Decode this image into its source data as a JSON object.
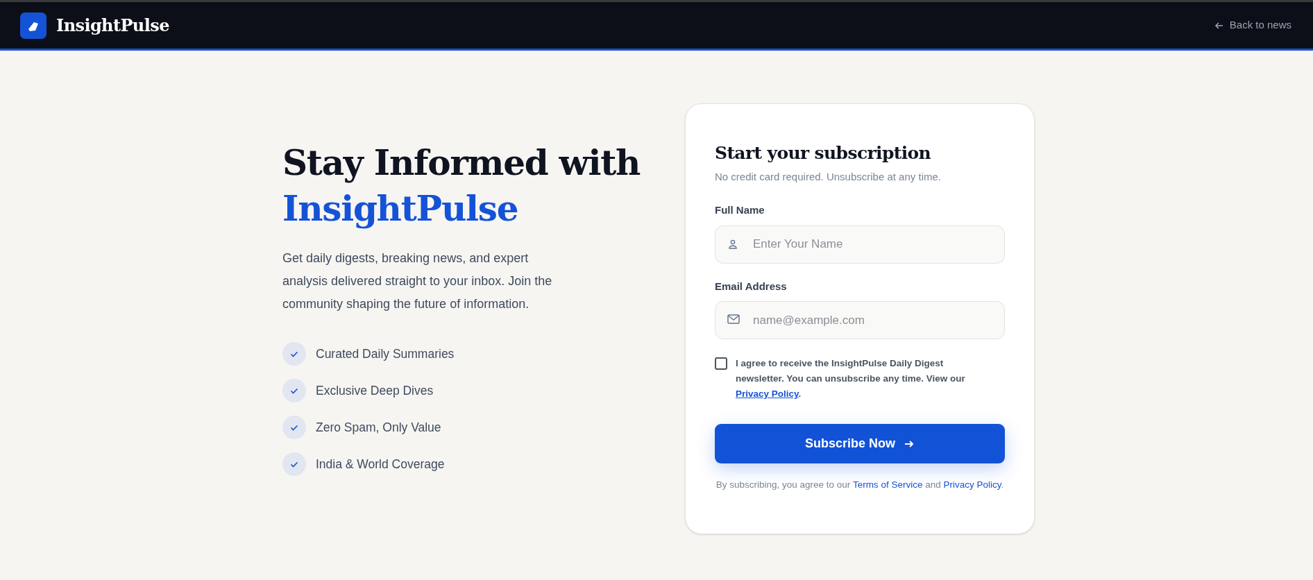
{
  "header": {
    "brand": "InsightPulse",
    "back_link": "Back to news"
  },
  "hero": {
    "title_parts": [
      {
        "kind": "text",
        "text": "Stay Informed with "
      },
      {
        "kind": "accent",
        "text": "InsightPulse"
      }
    ],
    "description": "Get daily digests, breaking news, and expert analysis delivered straight to your inbox. Join the community shaping the future of information.",
    "features": [
      {
        "label": "Curated Daily Summaries"
      },
      {
        "label": "Exclusive Deep Dives"
      },
      {
        "label": "Zero Spam, Only Value"
      },
      {
        "label": "India & World Coverage"
      }
    ]
  },
  "form": {
    "title": "Start your subscription",
    "subtitle": "No credit card required. Unsubscribe at any time.",
    "fields": [
      {
        "kind": "name",
        "label": "Full Name",
        "placeholder": "Enter Your Name"
      },
      {
        "kind": "email",
        "label": "Email Address",
        "placeholder": "name@example.com"
      }
    ],
    "consent": {
      "checked": false,
      "parts": [
        {
          "kind": "text",
          "text": "I agree to receive the InsightPulse Daily Digest newsletter. You can unsubscribe any time. View our "
        },
        {
          "kind": "link",
          "text": "Privacy Policy"
        },
        {
          "kind": "text",
          "text": "."
        }
      ]
    },
    "submit": "Subscribe Now",
    "terms_parts": [
      {
        "kind": "text",
        "text": "By subscribing, you agree to our "
      },
      {
        "kind": "link",
        "text": "Terms of Service"
      },
      {
        "kind": "text",
        "text": " and "
      },
      {
        "kind": "link",
        "text": "Privacy Policy"
      },
      {
        "kind": "text",
        "text": "."
      }
    ]
  }
}
